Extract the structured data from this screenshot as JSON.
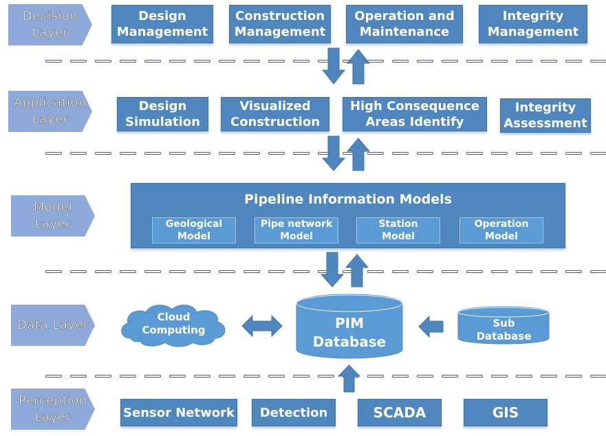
{
  "layers": [
    {
      "label": "Decision Layer",
      "items": [
        "Design Management",
        "Construction Management",
        "Operation and Maintenance",
        "Integrity Management"
      ]
    },
    {
      "label": "Application Layer",
      "items": [
        "Design Simulation",
        "Visualized Construction",
        "High Consequence Areas Identify",
        "Integrity Assessment"
      ]
    },
    {
      "label": "Model Layer",
      "title": "Pipeline Information Models",
      "items": [
        "Geological Model",
        "Pipe network Model",
        "Station Model",
        "Operation Model"
      ]
    },
    {
      "label": "Data Layer",
      "items": [
        "Cloud Computing",
        "PIM Database",
        "Sub Database"
      ]
    },
    {
      "label": "Perception Layer",
      "items": [
        "Sensor Network",
        "Detection",
        "SCADA",
        "GIS"
      ]
    }
  ],
  "labels": {
    "decision_l1": "Decision",
    "decision_l2": "Layer",
    "application_l1": "Application",
    "application_l2": "Layer",
    "model_l1": "Model",
    "model_l2": "Layer",
    "data_l1": "Data Layer",
    "perception_l1": "Perception",
    "perception_l2": "Layer",
    "dm_1": "Design",
    "dm_2": "Management",
    "cm_1": "Construction",
    "cm_2": "Management",
    "om_1": "Operation and",
    "om_2": "Maintenance",
    "im_1": "Integrity",
    "im_2": "Management",
    "ds_1": "Design",
    "ds_2": "Simulation",
    "vc_1": "Visualized",
    "vc_2": "Construction",
    "hca_1": "High Consequence",
    "hca_2": "Areas Identify",
    "ia_1": "Integrity",
    "ia_2": "Assessment",
    "pim_title": "Pipeline Information Models",
    "geo_1": "Geological",
    "geo_2": "Model",
    "pipe_1": "Pipe network",
    "pipe_2": "Model",
    "sta_1": "Station",
    "sta_2": "Model",
    "op_1": "Operation",
    "op_2": "Model",
    "cloud_1": "Cloud",
    "cloud_2": "Computing",
    "pimdb_1": "PIM",
    "pimdb_2": "Database",
    "subdb_1": "Sub",
    "subdb_2": "Database",
    "sensor": "Sensor Network",
    "detection": "Detection",
    "scada": "SCADA",
    "gis": "GIS"
  },
  "colors": {
    "layer_tag": "#8eaadb",
    "box": "#4f86bd",
    "light_box": "#5b9bd5",
    "arrow": "#4f86bd"
  }
}
